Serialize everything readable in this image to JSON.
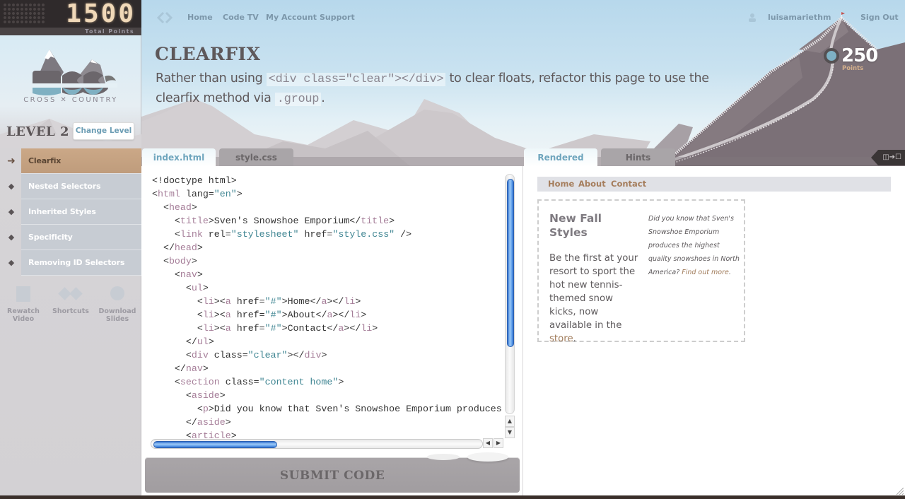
{
  "scoreboard": {
    "points": "1500",
    "label": "Total Points"
  },
  "brand": {
    "logo_text": "CROSS ✕ COUNTRY"
  },
  "level": {
    "title": "LEVEL 2",
    "change_label": "Change Level"
  },
  "lessons": [
    {
      "label": "Clearfix",
      "active": true,
      "icon": "arrow-right-icon"
    },
    {
      "label": "Nested Selectors",
      "active": false,
      "icon": "diamond-icon"
    },
    {
      "label": "Inherited Styles",
      "active": false,
      "icon": "diamond-icon"
    },
    {
      "label": "Specificity",
      "active": false,
      "icon": "diamond-icon"
    },
    {
      "label": "Removing ID Selectors",
      "active": false,
      "icon": "diamond-icon"
    }
  ],
  "tools": [
    {
      "line1": "Rewatch",
      "line2": "Video",
      "icon": "video-icon"
    },
    {
      "line1": "Shortcuts",
      "line2": "",
      "icon": "shortcuts-icon"
    },
    {
      "line1": "Download",
      "line2": "Slides",
      "icon": "slides-icon"
    }
  ],
  "nav": {
    "links": [
      "Home",
      "Code TV",
      "My Account",
      "Support"
    ],
    "username": "luisamariethm",
    "signout": "Sign Out"
  },
  "challenge": {
    "title": "CLEARFIX",
    "desc_part1": "Rather than using ",
    "desc_code1": "<div class=\"clear\"></div>",
    "desc_part2": " to clear floats, refactor this page to use the clearfix method via ",
    "desc_code2": ".group",
    "desc_part3": "."
  },
  "level_points": {
    "value": "250",
    "label": "Points"
  },
  "editor": {
    "tabs": [
      "index.html",
      "style.css"
    ],
    "active_tab": "index.html",
    "submit_label": "SUBMIT CODE",
    "lines": [
      [
        [
          "",
          "<!doctype html>"
        ]
      ],
      [
        [
          "",
          "<"
        ],
        [
          "t",
          "html"
        ],
        [
          "",
          " lang="
        ],
        [
          "v",
          "\"en\""
        ],
        [
          "",
          ">"
        ]
      ],
      [
        [
          "",
          "  <"
        ],
        [
          "t",
          "head"
        ],
        [
          "",
          ">"
        ]
      ],
      [
        [
          "",
          "    <"
        ],
        [
          "t",
          "title"
        ],
        [
          "",
          ">Sven's Snowshoe Emporium</"
        ],
        [
          "t",
          "title"
        ],
        [
          "",
          ">"
        ]
      ],
      [
        [
          "",
          "    <"
        ],
        [
          "t",
          "link"
        ],
        [
          "",
          " rel="
        ],
        [
          "v",
          "\"stylesheet\""
        ],
        [
          "",
          " href="
        ],
        [
          "v",
          "\"style.css\""
        ],
        [
          "",
          " />"
        ]
      ],
      [
        [
          "",
          "  </"
        ],
        [
          "t",
          "head"
        ],
        [
          "",
          ">"
        ]
      ],
      [
        [
          "",
          "  <"
        ],
        [
          "t",
          "body"
        ],
        [
          "",
          ">"
        ]
      ],
      [
        [
          "",
          "    <"
        ],
        [
          "t",
          "nav"
        ],
        [
          "",
          ">"
        ]
      ],
      [
        [
          "",
          "      <"
        ],
        [
          "t",
          "ul"
        ],
        [
          "",
          ">"
        ]
      ],
      [
        [
          "",
          "        <"
        ],
        [
          "t",
          "li"
        ],
        [
          "",
          "><"
        ],
        [
          "t",
          "a"
        ],
        [
          "",
          " href="
        ],
        [
          "v",
          "\"#\""
        ],
        [
          "",
          ">Home</"
        ],
        [
          "t",
          "a"
        ],
        [
          "",
          "></"
        ],
        [
          "t",
          "li"
        ],
        [
          "",
          ">"
        ]
      ],
      [
        [
          "",
          "        <"
        ],
        [
          "t",
          "li"
        ],
        [
          "",
          "><"
        ],
        [
          "t",
          "a"
        ],
        [
          "",
          " href="
        ],
        [
          "v",
          "\"#\""
        ],
        [
          "",
          ">About</"
        ],
        [
          "t",
          "a"
        ],
        [
          "",
          "></"
        ],
        [
          "t",
          "li"
        ],
        [
          "",
          ">"
        ]
      ],
      [
        [
          "",
          "        <"
        ],
        [
          "t",
          "li"
        ],
        [
          "",
          "><"
        ],
        [
          "t",
          "a"
        ],
        [
          "",
          " href="
        ],
        [
          "v",
          "\"#\""
        ],
        [
          "",
          ">Contact</"
        ],
        [
          "t",
          "a"
        ],
        [
          "",
          "></"
        ],
        [
          "t",
          "li"
        ],
        [
          "",
          ">"
        ]
      ],
      [
        [
          "",
          "      </"
        ],
        [
          "t",
          "ul"
        ],
        [
          "",
          ">"
        ]
      ],
      [
        [
          "",
          "      <"
        ],
        [
          "t",
          "div"
        ],
        [
          "",
          " class="
        ],
        [
          "v",
          "\"clear\""
        ],
        [
          "",
          "></"
        ],
        [
          "t",
          "div"
        ],
        [
          "",
          ">"
        ]
      ],
      [
        [
          "",
          "    </"
        ],
        [
          "t",
          "nav"
        ],
        [
          "",
          ">"
        ]
      ],
      [
        [
          "",
          "    <"
        ],
        [
          "t",
          "section"
        ],
        [
          "",
          " class="
        ],
        [
          "v",
          "\"content home\""
        ],
        [
          "",
          ">"
        ]
      ],
      [
        [
          "",
          "      <"
        ],
        [
          "t",
          "aside"
        ],
        [
          "",
          ">"
        ]
      ],
      [
        [
          "",
          "        <"
        ],
        [
          "t",
          "p"
        ],
        [
          "",
          ">Did you know that Sven's Snowshoe Emporium produces the highest"
        ]
      ],
      [
        [
          "",
          "      </"
        ],
        [
          "t",
          "aside"
        ],
        [
          "",
          ">"
        ]
      ],
      [
        [
          "",
          "      <"
        ],
        [
          "t",
          "article"
        ],
        [
          "",
          ">"
        ]
      ]
    ]
  },
  "preview": {
    "tabs": [
      "Rendered",
      "Hints"
    ],
    "active_tab": "Rendered",
    "nav_links": [
      "Home",
      "About",
      "Contact"
    ],
    "heading": "New Fall Styles",
    "body_before": "Be the first at your resort to sport the hot new tennis-themed snow kicks, now available in the ",
    "body_link": "store",
    "body_after": ".",
    "aside_text": "Did you know that Sven's Snowshoe Emporium produces the highest quality snowshoes in North America? ",
    "aside_link": "Find out more",
    "aside_after": "."
  },
  "colors": {
    "accent_blue": "#6ea5bd",
    "active_lesson": "#c4a180",
    "link_brown": "#a57d5c",
    "tag_color": "#a57d98",
    "value_color": "#3f8592"
  }
}
